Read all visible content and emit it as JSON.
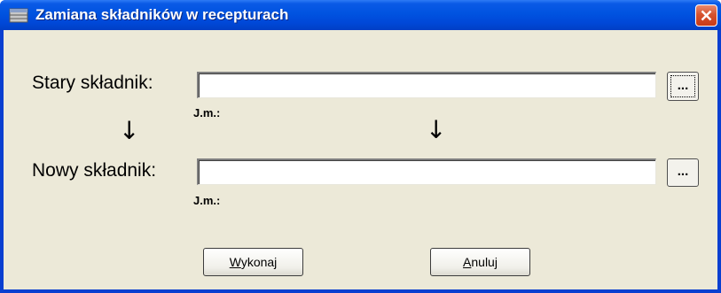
{
  "window": {
    "title": "Zamiana składników w recepturach",
    "close_symbol": "✕",
    "title_icon": "table-icon"
  },
  "form": {
    "old_label": "Stary składnik:",
    "old_value": "",
    "old_unit_label": "J.m.:",
    "new_label": "Nowy składnik:",
    "new_value": "",
    "new_unit_label": "J.m.:",
    "browse_label": "...",
    "arrow_symbol": "↓"
  },
  "buttons": {
    "execute_label": "Wykonaj",
    "execute_accel": "W",
    "execute_rest": "ykonaj",
    "cancel_label": "Anuluj",
    "cancel_accel": "A",
    "cancel_rest": "nuluj"
  },
  "colors": {
    "titlebar": "#0053e0",
    "dialog_bg": "#ece9d8",
    "close_red": "#d6532f"
  }
}
